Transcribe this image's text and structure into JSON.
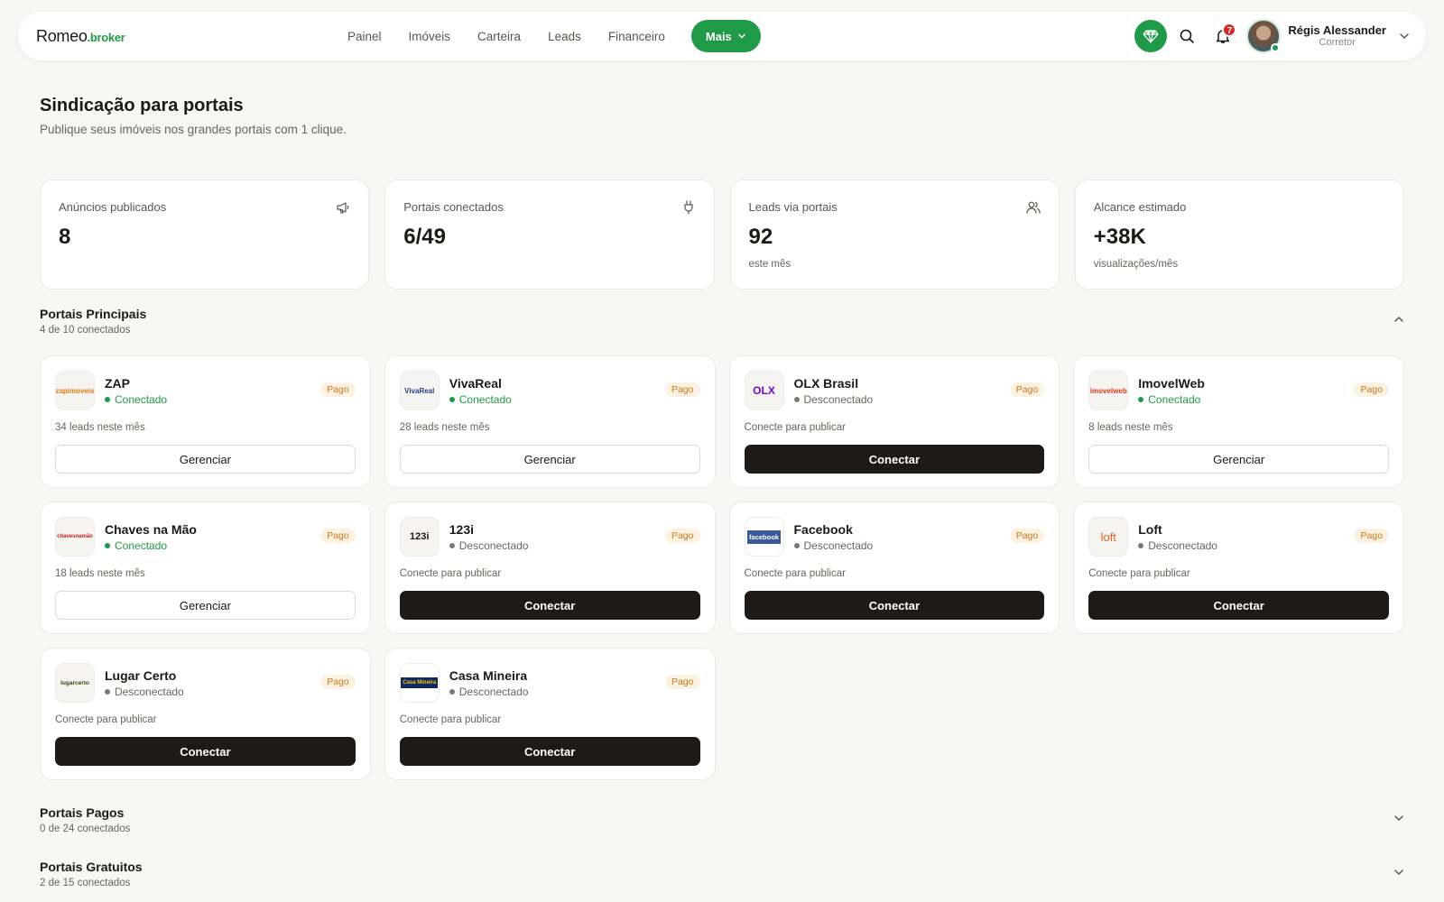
{
  "brand": {
    "name": "Romeo",
    "suffix": ".broker"
  },
  "nav": {
    "links": [
      "Painel",
      "Imóveis",
      "Carteira",
      "Leads",
      "Financeiro"
    ],
    "more_label": "Mais"
  },
  "notifications": {
    "count": "7"
  },
  "user": {
    "name": "Régis Alessander",
    "role": "Corretor"
  },
  "header": {
    "title": "Sindicação para portais",
    "subtitle": "Publique seus imóveis nos grandes portais com 1 clique."
  },
  "stats": [
    {
      "label": "Anúncios publicados",
      "value": "8",
      "note": "",
      "icon": "megaphone-icon"
    },
    {
      "label": "Portais conectados",
      "value": "6/49",
      "note": "",
      "icon": "plug-icon"
    },
    {
      "label": "Leads via portais",
      "value": "92",
      "note": "este mês",
      "icon": "users-icon"
    },
    {
      "label": "Alcance estimado",
      "value": "+38K",
      "note": "visualizações/mês",
      "icon": ""
    }
  ],
  "sections": {
    "main": {
      "title": "Portais Principais",
      "subtitle": "4 de 10 conectados",
      "expanded": true
    },
    "paid": {
      "title": "Portais Pagos",
      "subtitle": "0 de 24 conectados",
      "expanded": false
    },
    "free": {
      "title": "Portais Gratuitos",
      "subtitle": "2 de 15 conectados",
      "expanded": false
    }
  },
  "portals": [
    {
      "name": "ZAP",
      "status": "Conectado",
      "connected": true,
      "badge": "Pago",
      "note": "34 leads neste mês",
      "button": "Gerenciar",
      "logo_text": "zapimoveis"
    },
    {
      "name": "VivaReal",
      "status": "Conectado",
      "connected": true,
      "badge": "Pago",
      "note": "28 leads neste mês",
      "button": "Gerenciar",
      "logo_text": "VivaReal"
    },
    {
      "name": "OLX Brasil",
      "status": "Desconectado",
      "connected": false,
      "badge": "Pago",
      "note": "Conecte para publicar",
      "button": "Conectar",
      "logo_text": "OLX"
    },
    {
      "name": "ImovelWeb",
      "status": "Conectado",
      "connected": true,
      "badge": "Pago",
      "note": "8 leads neste mês",
      "button": "Gerenciar",
      "logo_text": "imovelweb"
    },
    {
      "name": "Chaves na Mão",
      "status": "Conectado",
      "connected": true,
      "badge": "Pago",
      "note": "18 leads neste mês",
      "button": "Gerenciar",
      "logo_text": "chavesnamão"
    },
    {
      "name": "123i",
      "status": "Desconectado",
      "connected": false,
      "badge": "Pago",
      "note": "Conecte para publicar",
      "button": "Conectar",
      "logo_text": "123i"
    },
    {
      "name": "Facebook",
      "status": "Desconectado",
      "connected": false,
      "badge": "Pago",
      "note": "Conecte para publicar",
      "button": "Conectar",
      "logo_text": "facebook"
    },
    {
      "name": "Loft",
      "status": "Desconectado",
      "connected": false,
      "badge": "Pago",
      "note": "Conecte para publicar",
      "button": "Conectar",
      "logo_text": "loft"
    },
    {
      "name": "Lugar Certo",
      "status": "Desconectado",
      "connected": false,
      "badge": "Pago",
      "note": "Conecte para publicar",
      "button": "Conectar",
      "logo_text": "lugarcerto"
    },
    {
      "name": "Casa Mineira",
      "status": "Desconectado",
      "connected": false,
      "badge": "Pago",
      "note": "Conecte para publicar",
      "button": "Conectar",
      "logo_text": "Casa Mineira"
    }
  ],
  "colors": {
    "accent": "#1f9a48",
    "dark_button": "#1d1a17",
    "badge": "#c87a1c",
    "background": "#f7f7f5"
  }
}
